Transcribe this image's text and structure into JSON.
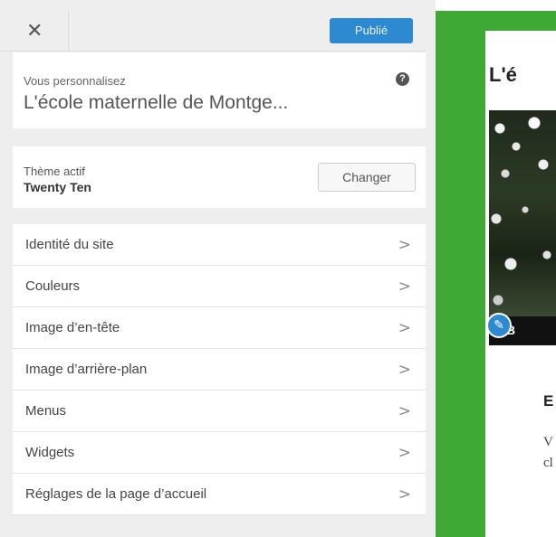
{
  "header": {
    "close_icon": "close-icon",
    "close_glyph": "✕",
    "publish_label": "Publié"
  },
  "info": {
    "label": "Vous personnalisez",
    "help_glyph": "?",
    "site_title": "L'école maternelle de Montge..."
  },
  "theme": {
    "label": "Thème actif",
    "name": "Twenty Ten",
    "change_label": "Changer"
  },
  "menu": {
    "chevron_glyph": ">",
    "items": [
      {
        "label": "Identité du site"
      },
      {
        "label": "Couleurs"
      },
      {
        "label": "Image d’en-tête"
      },
      {
        "label": "Image d’arrière-plan"
      },
      {
        "label": "Menus"
      },
      {
        "label": "Widgets"
      },
      {
        "label": "Réglages de la page d’accueil"
      }
    ]
  },
  "preview": {
    "title": "L'é",
    "caption": "B",
    "edit_glyph": "✎",
    "heading": "E",
    "body_lines": [
      "V",
      "cl"
    ]
  },
  "colors": {
    "accent": "#2e8ad0",
    "preview_green": "#3fa935",
    "panel_bg": "#eeeeee"
  }
}
